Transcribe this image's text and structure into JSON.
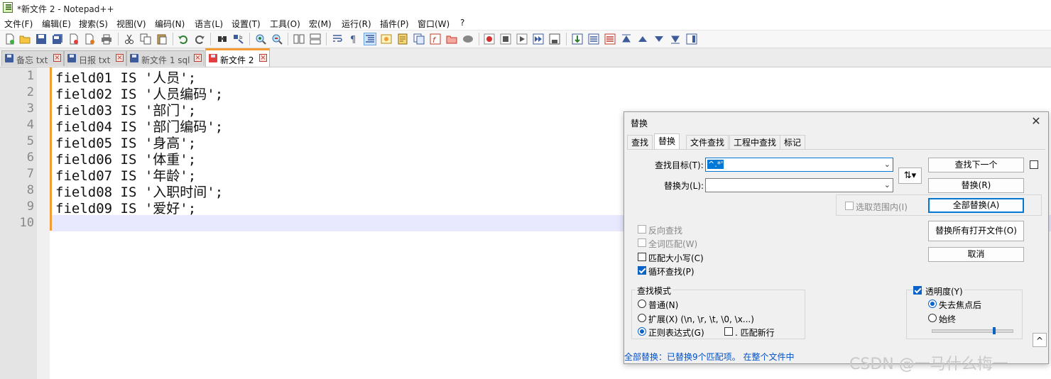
{
  "window": {
    "title": "*新文件 2 - Notepad++"
  },
  "menu": [
    "文件(F)",
    "编辑(E)",
    "搜索(S)",
    "视图(V)",
    "编码(N)",
    "语言(L)",
    "设置(T)",
    "工具(O)",
    "宏(M)",
    "运行(R)",
    "插件(P)",
    "窗口(W)",
    "?"
  ],
  "tabs": [
    {
      "label": "备忘 txt",
      "active": false
    },
    {
      "label": "日报 txt",
      "active": false
    },
    {
      "label": "新文件 1 sql",
      "active": false
    },
    {
      "label": "新文件 2",
      "active": true
    }
  ],
  "editor": {
    "line_numbers": [
      "1",
      "2",
      "3",
      "4",
      "5",
      "6",
      "7",
      "8",
      "9",
      "10"
    ],
    "lines": [
      "field01 IS '人员';",
      "field02 IS '人员编码';",
      "field03 IS '部门';",
      "field04 IS '部门编码';",
      "field05 IS '身高';",
      "field06 IS '体重';",
      "field07 IS '年龄';",
      "field08 IS '入职时间';",
      "field09 IS '爱好';",
      ""
    ]
  },
  "dialog": {
    "title": "替换",
    "tabs": [
      "查找",
      "替换",
      "文件查找",
      "工程中查找",
      "标记"
    ],
    "active_tab": "替换",
    "find_label": "查找目标(T):",
    "find_value": "^.*'",
    "replace_label": "替换为(L):",
    "replace_value": "",
    "swap_glyph": "⇅▾",
    "buttons": {
      "find_next": "查找下一个",
      "replace": "替换(R)",
      "replace_all": "全部替换(A)",
      "replace_all_open": "替换所有打开文件(O)",
      "cancel": "取消"
    },
    "in_selection": "选取范围内(I)",
    "options": [
      {
        "label": "反向查找",
        "checked": false,
        "disabled": true
      },
      {
        "label": "全词匹配(W)",
        "checked": false,
        "disabled": true
      },
      {
        "label": "匹配大小写(C)",
        "checked": false,
        "disabled": false
      },
      {
        "label": "循环查找(P)",
        "checked": true,
        "disabled": false
      }
    ],
    "search_mode": {
      "title": "查找模式",
      "normal": "普通(N)",
      "extended": "扩展(X) (\\n, \\r, \\t, \\0, \\x...)",
      "regex": "正则表达式(G)",
      "newline": ". 匹配新行",
      "selected": "regex"
    },
    "transparency": {
      "label": "透明度(Y)",
      "enabled": true,
      "on_lose_focus": "失去焦点后",
      "always": "始终",
      "selected": "on_lose_focus",
      "level": 0.78
    },
    "collapse_glyph": "^",
    "status": "全部替换：已替换9个匹配项。 在整个文件中"
  },
  "watermark": "CSDN @一马什么梅一"
}
